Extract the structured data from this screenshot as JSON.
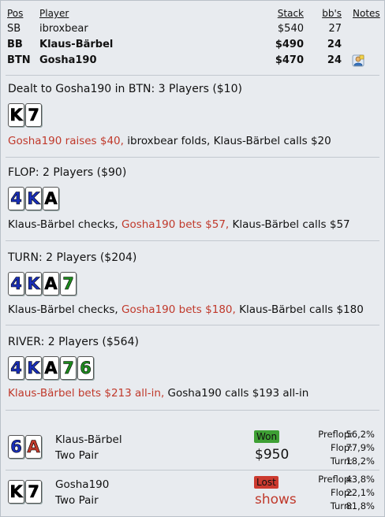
{
  "header": {
    "col_pos": "Pos",
    "col_player": "Player",
    "col_stack": "Stack",
    "col_bb": "bb's",
    "col_notes": "Notes"
  },
  "players": [
    {
      "pos": "SB",
      "name": "ibroxbear",
      "stack": "$540",
      "bb": "27",
      "bold": false
    },
    {
      "pos": "BB",
      "name": "Klaus-Bärbel",
      "stack": "$490",
      "bb": "24",
      "bold": true
    },
    {
      "pos": "BTN",
      "name": "Gosha190",
      "stack": "$470",
      "bb": "24",
      "bold": true,
      "note_icon": "user-note-icon"
    }
  ],
  "preflop": {
    "title": "Dealt to Gosha190 in BTN: 3 Players ($10)",
    "cards": [
      {
        "rank": "K",
        "color": "#000000"
      },
      {
        "rank": "7",
        "color": "#000000"
      }
    ],
    "action_red": "Gosha190 raises $40,",
    "action_rest": " ibroxbear folds, Klaus-Bärbel calls $20"
  },
  "flop": {
    "title": "FLOP: 2 Players ($90)",
    "cards": [
      {
        "rank": "4",
        "color": "#1a2fb8"
      },
      {
        "rank": "K",
        "color": "#1a2fb8"
      },
      {
        "rank": "A",
        "color": "#000000"
      }
    ],
    "action_a": "Klaus-Bärbel checks, ",
    "action_red": "Gosha190 bets $57,",
    "action_b": " Klaus-Bärbel calls $57"
  },
  "turn": {
    "title": "TURN: 2 Players ($204)",
    "cards": [
      {
        "rank": "4",
        "color": "#1a2fb8"
      },
      {
        "rank": "K",
        "color": "#1a2fb8"
      },
      {
        "rank": "A",
        "color": "#000000"
      },
      {
        "rank": "7",
        "color": "#1e8a1e"
      }
    ],
    "action_a": "Klaus-Bärbel checks, ",
    "action_red": "Gosha190 bets $180,",
    "action_b": " Klaus-Bärbel calls $180"
  },
  "river": {
    "title": "RIVER: 2 Players ($564)",
    "cards": [
      {
        "rank": "4",
        "color": "#1a2fb8"
      },
      {
        "rank": "K",
        "color": "#1a2fb8"
      },
      {
        "rank": "A",
        "color": "#000000"
      },
      {
        "rank": "7",
        "color": "#1e8a1e"
      },
      {
        "rank": "6",
        "color": "#1e8a1e"
      }
    ],
    "action_red": "Klaus-Bärbel bets $213 all-in,",
    "action_rest": " Gosha190 calls $193 all-in"
  },
  "showdown": [
    {
      "cards": [
        {
          "rank": "6",
          "color": "#1a2fb8"
        },
        {
          "rank": "A",
          "color": "#c0392b"
        }
      ],
      "name": "Klaus-Bärbel",
      "hand": "Two Pair",
      "result": "Won",
      "amount": "$950",
      "equity": [
        {
          "street": "Preflop:",
          "value": "56,2%"
        },
        {
          "street": "Flop:",
          "value": "77,9%"
        },
        {
          "street": "Turn:",
          "value": "18,2%"
        }
      ]
    },
    {
      "cards": [
        {
          "rank": "K",
          "color": "#000000"
        },
        {
          "rank": "7",
          "color": "#000000"
        }
      ],
      "name": "Gosha190",
      "hand": "Two Pair",
      "result": "Lost",
      "amount": "shows",
      "equity": [
        {
          "street": "Preflop:",
          "value": "43,8%"
        },
        {
          "street": "Flop:",
          "value": "22,1%"
        },
        {
          "street": "Turn:",
          "value": "81,8%"
        }
      ]
    }
  ],
  "colors": {
    "action_red": "#c0392b",
    "won": "#3ea034",
    "lost": "#cc3a2f"
  }
}
